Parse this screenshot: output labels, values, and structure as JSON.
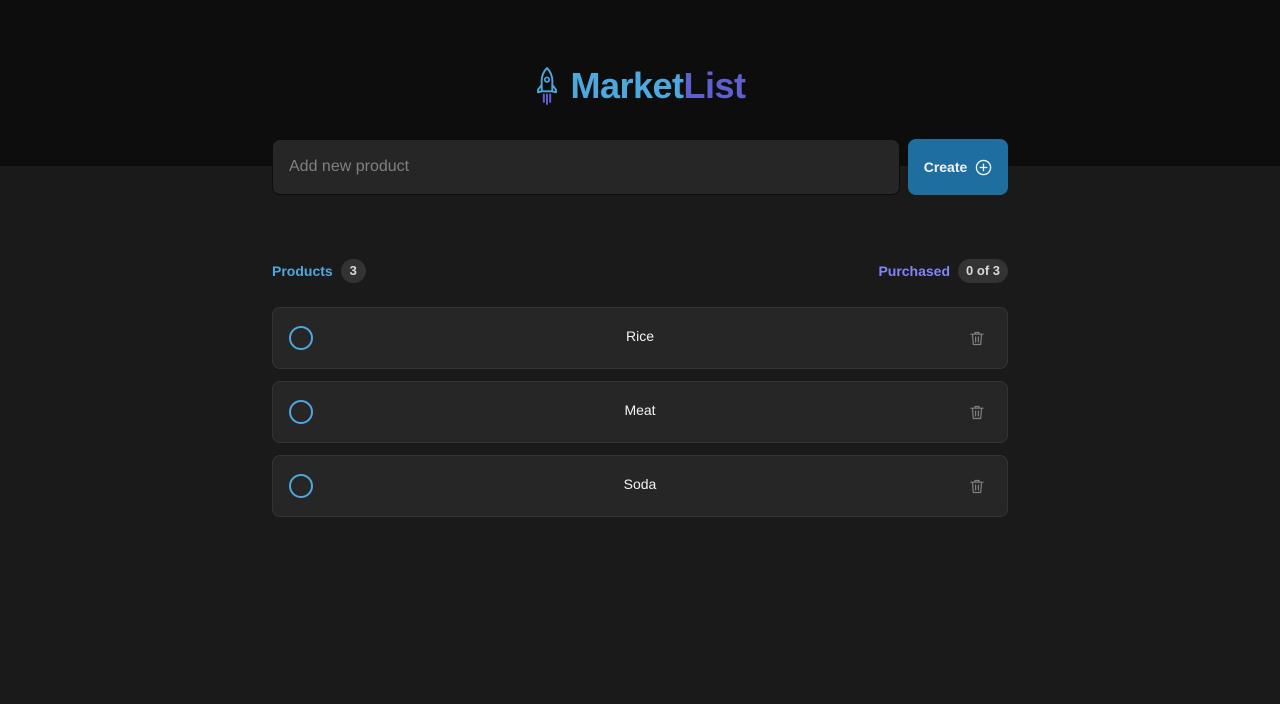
{
  "header": {
    "logo_icon": "rocket-icon",
    "logo_part_1": "Market",
    "logo_part_2": "List"
  },
  "form": {
    "placeholder": "Add new product",
    "value": "",
    "create_label": "Create",
    "create_icon": "plus-circle-icon"
  },
  "info": {
    "products_label": "Products",
    "products_count": "3",
    "purchased_label": "Purchased",
    "purchased_count": "0 of 3"
  },
  "items": [
    {
      "name": "Rice",
      "checked": false
    },
    {
      "name": "Meat",
      "checked": false
    },
    {
      "name": "Soda",
      "checked": false
    }
  ],
  "colors": {
    "blue": "#4ea8de",
    "purple": "#5e60ce",
    "purple_light": "#8284fa",
    "button": "#1e6f9f",
    "header_bg": "#0d0d0d",
    "page_bg": "#1a1a1a",
    "card_bg": "#262626"
  }
}
